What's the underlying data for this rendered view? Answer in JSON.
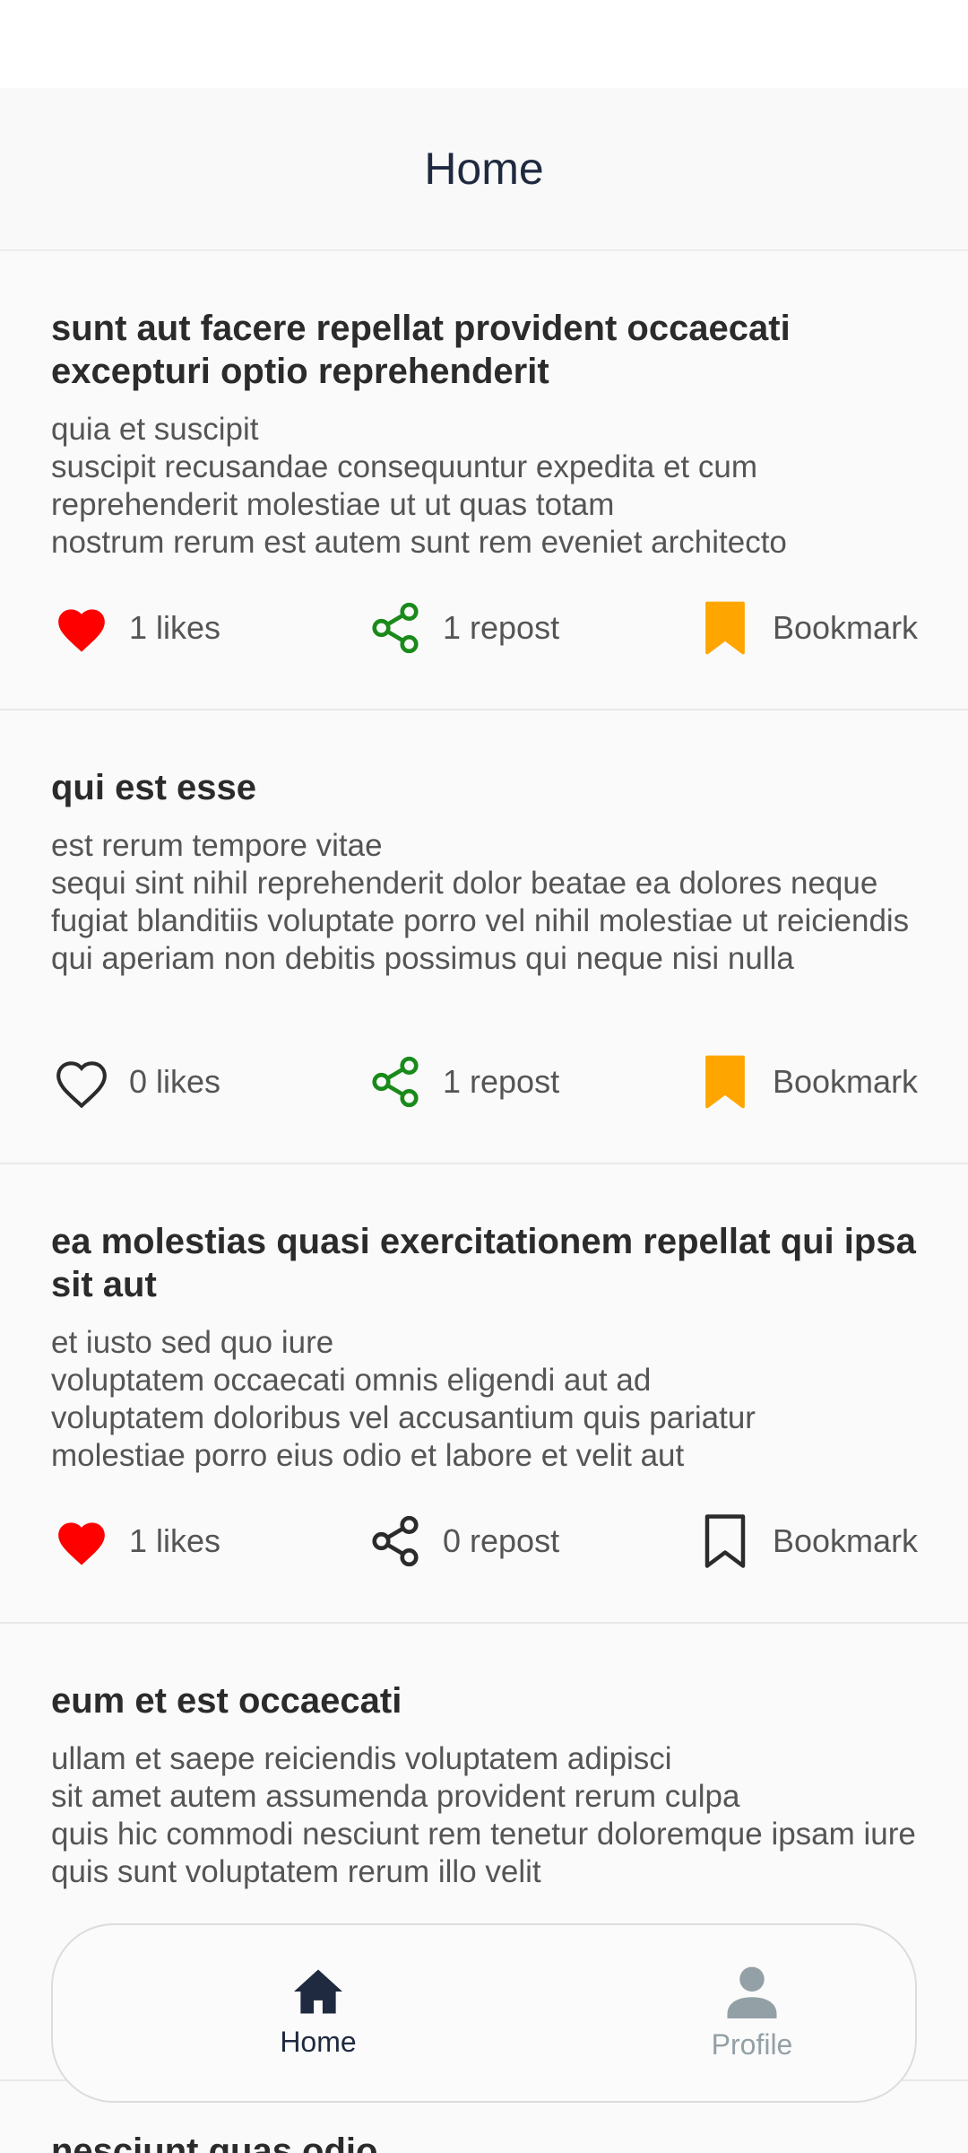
{
  "header": {
    "title": "Home"
  },
  "posts": [
    {
      "title": "sunt aut facere repellat provident occaecati excepturi optio reprehenderit",
      "body": "quia et suscipit\nsuscipit recusandae consequuntur expedita et cum reprehenderit molestiae ut ut quas totam\nnostrum rerum est autem sunt rem eveniet architecto",
      "likes_label": "1 likes",
      "repost_label": "1 repost",
      "bookmark_label": "Bookmark",
      "liked": true,
      "reposted": true,
      "bookmarked": true
    },
    {
      "title": "qui est esse",
      "body": "est rerum tempore vitae\nsequi sint nihil reprehenderit dolor beatae ea dolores neque fugiat blanditiis voluptate porro vel nihil molestiae ut reiciendis\nqui aperiam non debitis possimus qui neque nisi nulla",
      "likes_label": "0 likes",
      "repost_label": "1 repost",
      "bookmark_label": "Bookmark",
      "liked": false,
      "reposted": true,
      "bookmarked": true
    },
    {
      "title": "ea molestias quasi exercitationem repellat qui ipsa sit aut",
      "body": "et iusto sed quo iure\nvoluptatem occaecati omnis eligendi aut ad\nvoluptatem doloribus vel accusantium quis pariatur\nmolestiae porro eius odio et labore et velit aut",
      "likes_label": "1 likes",
      "repost_label": "0 repost",
      "bookmark_label": "Bookmark",
      "liked": true,
      "reposted": false,
      "bookmarked": false
    },
    {
      "title": "eum et est occaecati",
      "body": "ullam et saepe reiciendis voluptatem adipisci\nsit amet autem assumenda provident rerum culpa\nquis hic commodi nesciunt rem tenetur doloremque ipsam iure\nquis sunt voluptatem rerum illo velit"
    },
    {
      "title": "nesciunt quas odio"
    }
  ],
  "colors": {
    "liked": "#ff0000",
    "reposted": "#1a8a1a",
    "bookmarked": "#ffa500",
    "inactive_icon": "#2b2b2b",
    "nav_active": "#1f2a40",
    "nav_inactive": "#93a1a6"
  },
  "icons": {
    "like": "heart-icon",
    "repost": "share-icon",
    "bookmark": "bookmark-icon",
    "home": "home-icon",
    "profile": "user-icon"
  },
  "bottom_nav": {
    "items": [
      {
        "label": "Home",
        "icon": "home-icon",
        "active": true
      },
      {
        "label": "Profile",
        "icon": "user-icon",
        "active": false
      }
    ]
  }
}
